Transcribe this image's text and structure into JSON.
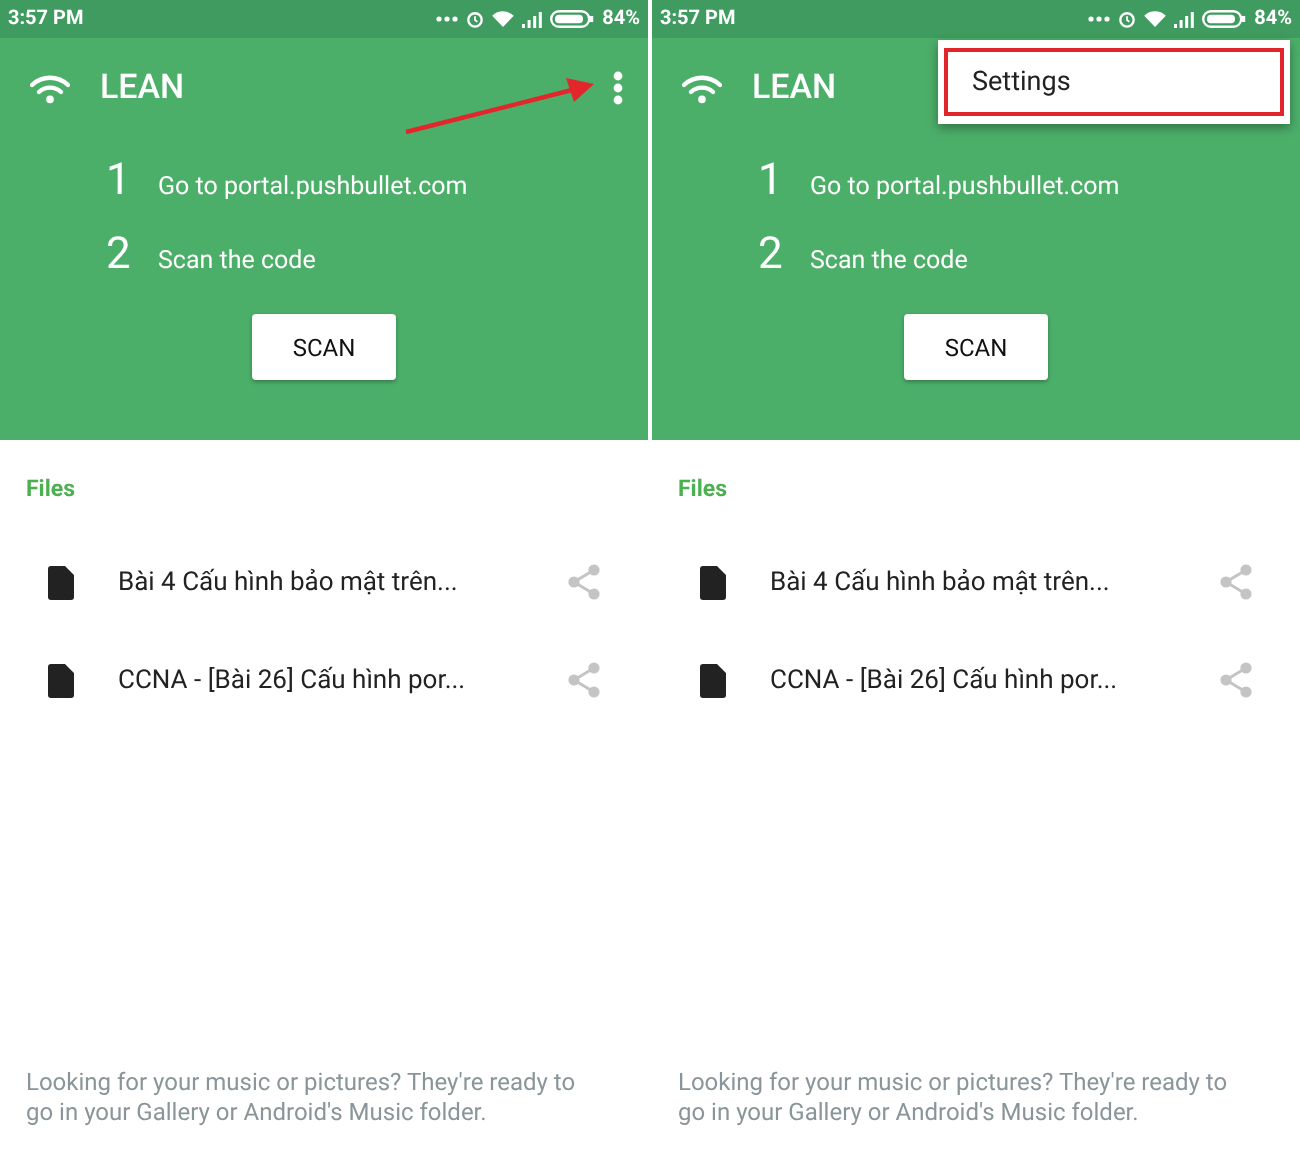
{
  "screens": [
    {
      "status_bar": {
        "time": "3:57 PM",
        "battery": "84%"
      },
      "app_bar": {
        "title": "LEAN"
      },
      "arrow_to_menu": true,
      "steps": [
        {
          "number": "1",
          "text": "Go to portal.pushbullet.com"
        },
        {
          "number": "2",
          "text": "Scan the code"
        }
      ],
      "scan_button": "SCAN",
      "section_title": "Files",
      "files": [
        {
          "name": "Bài 4 Cấu hình bảo mật trên..."
        },
        {
          "name": "CCNA - [Bài 26] Cấu hình por..."
        }
      ],
      "footer": "Looking for your music or pictures? They're ready to go in your Gallery or Android's Music folder."
    },
    {
      "status_bar": {
        "time": "3:57 PM",
        "battery": "84%"
      },
      "app_bar": {
        "title": "LEAN"
      },
      "arrow_to_menu": false,
      "menu": {
        "items": [
          {
            "label": "Settings",
            "highlighted": true
          }
        ]
      },
      "steps": [
        {
          "number": "1",
          "text": "Go to portal.pushbullet.com"
        },
        {
          "number": "2",
          "text": "Scan the code"
        }
      ],
      "scan_button": "SCAN",
      "section_title": "Files",
      "files": [
        {
          "name": "Bài 4 Cấu hình bảo mật trên..."
        },
        {
          "name": "CCNA - [Bài 26] Cấu hình por..."
        }
      ],
      "footer": "Looking for your music or pictures? They're ready to go in your Gallery or Android's Music folder."
    }
  ]
}
